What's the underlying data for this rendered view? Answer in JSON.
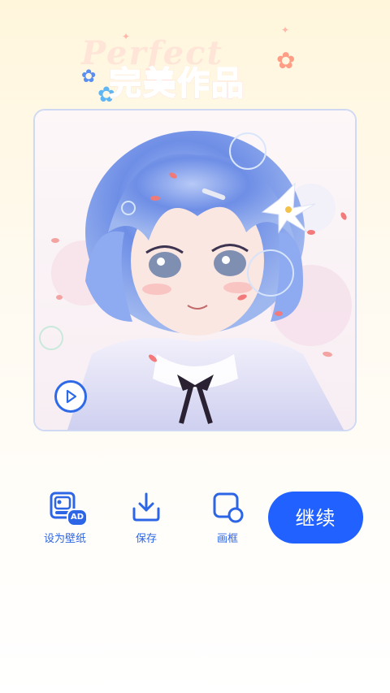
{
  "header": {
    "title": "完美作品",
    "ghost_text": "Perfect"
  },
  "artwork": {
    "play_icon": "play-icon"
  },
  "actions": {
    "wallpaper_label": "设为壁纸",
    "wallpaper_badge": "AD",
    "save_label": "保存",
    "frame_label": "画框"
  },
  "continue_label": "继续",
  "colors": {
    "accent": "#2161ff",
    "icon_blue": "#2c65e6"
  }
}
